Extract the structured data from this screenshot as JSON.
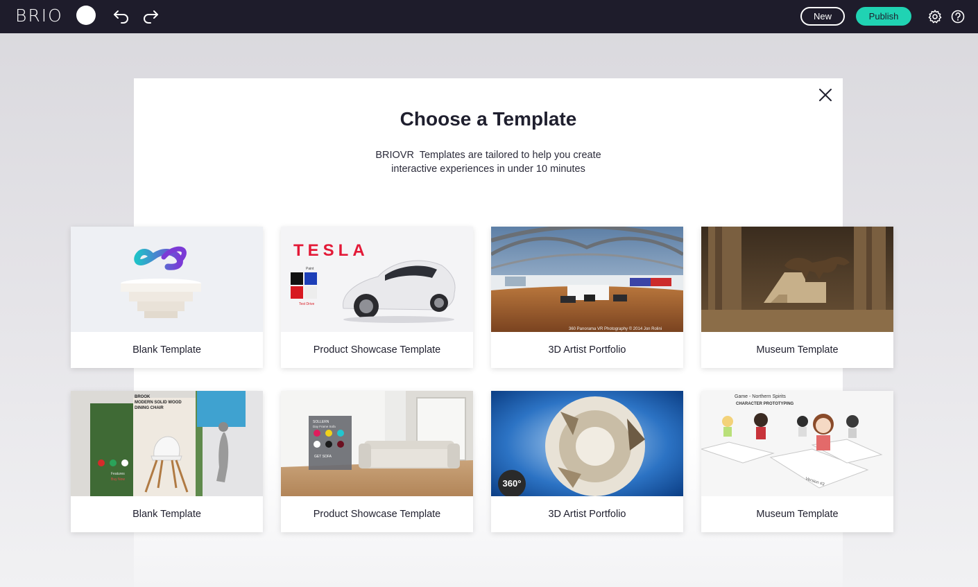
{
  "app": {
    "logo": "BRIO",
    "new_label": "New",
    "publish_label": "Publish",
    "accent_color": "#20d3b3",
    "topbar_color": "#1e1c2b",
    "icons": [
      "undo-icon",
      "redo-icon",
      "settings-gear-icon",
      "help-icon",
      "close-icon"
    ]
  },
  "modal": {
    "title": "Choose a Template",
    "subtitle_line1": "BRIOVR  Templates are tailored to help you create",
    "subtitle_line2": "interactive experiences in under 10 minutes"
  },
  "templates": [
    {
      "label": "Blank Template",
      "thumb_icon": "infinity-logo-pedestal"
    },
    {
      "label": "Product Showcase Template",
      "thumb_icon": "car-showcase",
      "thumb_text": {
        "brand": "TESLA",
        "paint": "Paint",
        "test_drive": "Test Drive"
      }
    },
    {
      "label": "3D Artist Portfolio",
      "thumb_icon": "panorama-office",
      "thumb_text": {
        "caption": "360 Panorama VR Photography © 2014 Jon Rolini"
      }
    },
    {
      "label": "Museum Template",
      "thumb_icon": "dinosaur-exhibit"
    },
    {
      "label": "Blank Template",
      "thumb_icon": "chair-gallery",
      "thumb_text": {
        "heading1": "BROOK",
        "heading2": "MODERN SOLID WOOD",
        "heading3": "DINING CHAIR",
        "features": "Features",
        "buy": "Buy Now"
      }
    },
    {
      "label": "Product Showcase Template",
      "thumb_icon": "sofa-room",
      "thumb_text": {
        "name": "SOLLERN",
        "desc": "Day Frame Sofa",
        "cta": "GET SOFA"
      }
    },
    {
      "label": "3D Artist Portfolio",
      "thumb_icon": "tiny-planet-360",
      "thumb_text": {
        "badge": "360°"
      }
    },
    {
      "label": "Museum Template",
      "thumb_icon": "character-prototyping",
      "thumb_text": {
        "line1": "Game - Northern Spirits",
        "line2": "CHARACTER PROTOTYPING",
        "version": "Version #3"
      }
    }
  ]
}
